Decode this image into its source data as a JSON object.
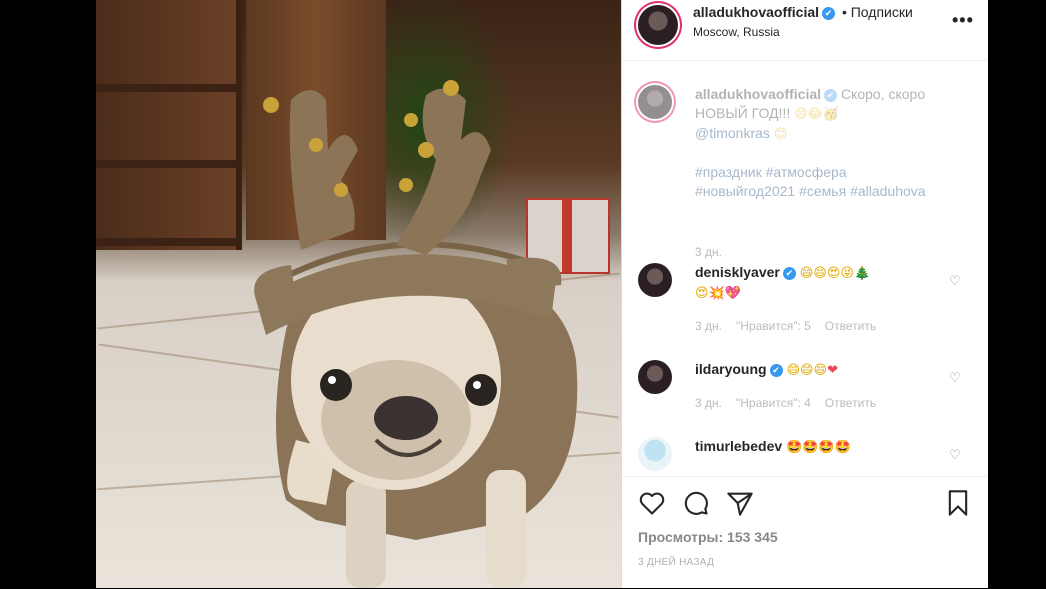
{
  "post": {
    "author": "alladukhovaofficial",
    "follow_label": "• Подписки",
    "location": "Moscow, Russia",
    "more_icon": "more-dots-icon",
    "more_glyph": "•••"
  },
  "caption": {
    "user": "alladukhovaofficial",
    "text_line1": "Скоро, скоро",
    "text_line2": "НОВЫЙ ГОД!!!",
    "emoji1": "😄😂🥳",
    "mention": "@timonkras",
    "emoji2": "😊",
    "hashtags_line1": "#праздник #атмосфера",
    "hashtags_line2": "#новыйгод2021 #семья #alladuhova",
    "time": "3 дн."
  },
  "comments": [
    {
      "user": "denisklyaver",
      "emoji_line1": "😄😄😍😝",
      "emoji_tree": "🎄",
      "emoji_line2": "😍💥",
      "emoji_heart": "💖",
      "time": "3 дн.",
      "likes": "\"Нравится\": 5",
      "reply": "Ответить"
    },
    {
      "user": "ildaryoung",
      "emoji_line1": "😄😄😄",
      "emoji_heart": "❤",
      "time": "3 дн.",
      "likes": "\"Нравится\": 4",
      "reply": "Ответить"
    },
    {
      "user": "timurlebedev",
      "emoji_line1": "🤩🤩🤩🤩"
    }
  ],
  "actions": {
    "views_label": "Просмотры: 153 345",
    "posted_ago": "3 дней назад"
  },
  "colors": {
    "verified": "#3897f0",
    "story_ring": "#e1306c",
    "link": "#00376b"
  }
}
